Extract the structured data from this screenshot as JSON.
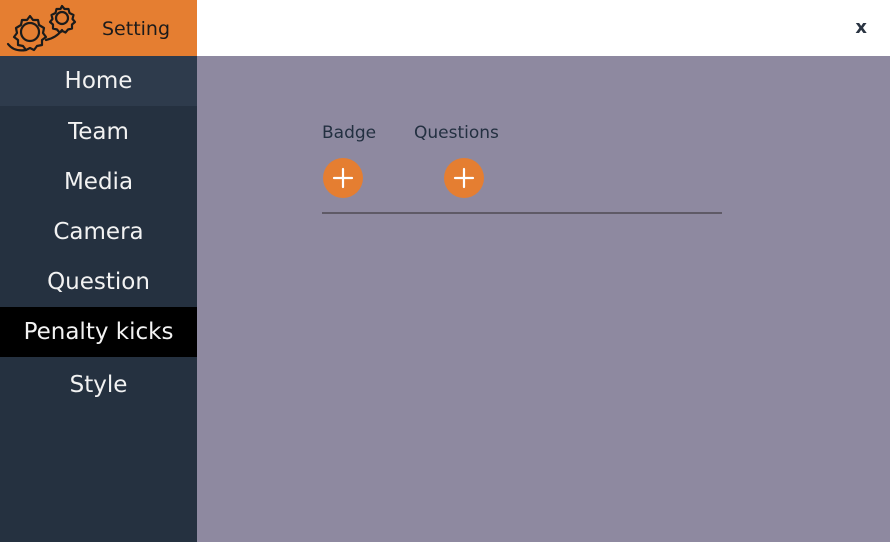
{
  "header": {
    "title": "Setting",
    "brand_icon": "gears-icon",
    "close_label": "x"
  },
  "sidebar": {
    "items": [
      {
        "label": "Home",
        "state": "active"
      },
      {
        "label": "Team",
        "state": ""
      },
      {
        "label": "Media",
        "state": ""
      },
      {
        "label": "Camera",
        "state": ""
      },
      {
        "label": "Question",
        "state": ""
      },
      {
        "label": "Penalty kicks",
        "state": "selected"
      },
      {
        "label": "Style",
        "state": ""
      }
    ]
  },
  "main": {
    "badge_label": "Badge",
    "questions_label": "Questions",
    "add_icon": "plus-icon"
  },
  "colors": {
    "accent": "#e57e31",
    "sidebar": "#253140",
    "content_bg": "#8e89a0",
    "selected": "#000000"
  }
}
